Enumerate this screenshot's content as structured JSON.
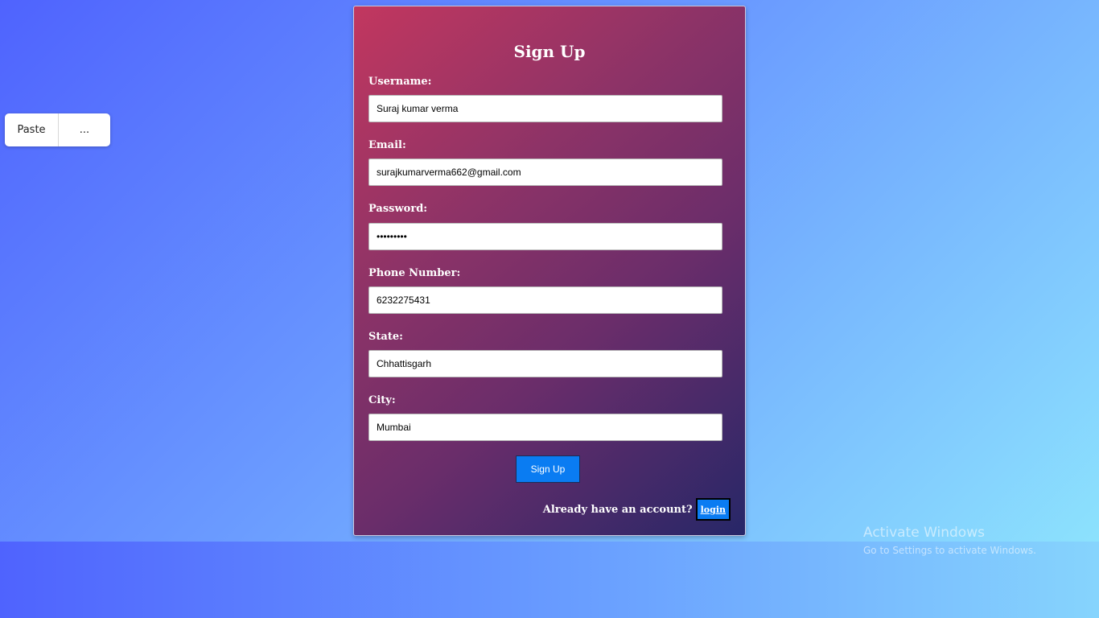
{
  "context_menu": {
    "paste_label": "Paste",
    "more_label": "..."
  },
  "form": {
    "title": "Sign Up",
    "fields": [
      {
        "label": "Username:",
        "value": "Suraj kumar verma"
      },
      {
        "label": "Email:",
        "value": "surajkumarverma662@gmail.com"
      },
      {
        "label": "Password:",
        "value": "•••••••••"
      },
      {
        "label": "Phone Number:",
        "value": "6232275431"
      },
      {
        "label": "State:",
        "value": "Chhattisgarh"
      },
      {
        "label": "City:",
        "value": "Mumbai"
      }
    ],
    "submit_label": "Sign Up",
    "footer_text": "Already have an account?",
    "login_label": "login"
  },
  "watermark": {
    "title": "Activate Windows",
    "subtitle": "Go to Settings to activate Windows."
  },
  "colors": {
    "button": "#0a7cf2",
    "card_gradient_start": "#c2375f",
    "card_gradient_end": "#272768"
  }
}
